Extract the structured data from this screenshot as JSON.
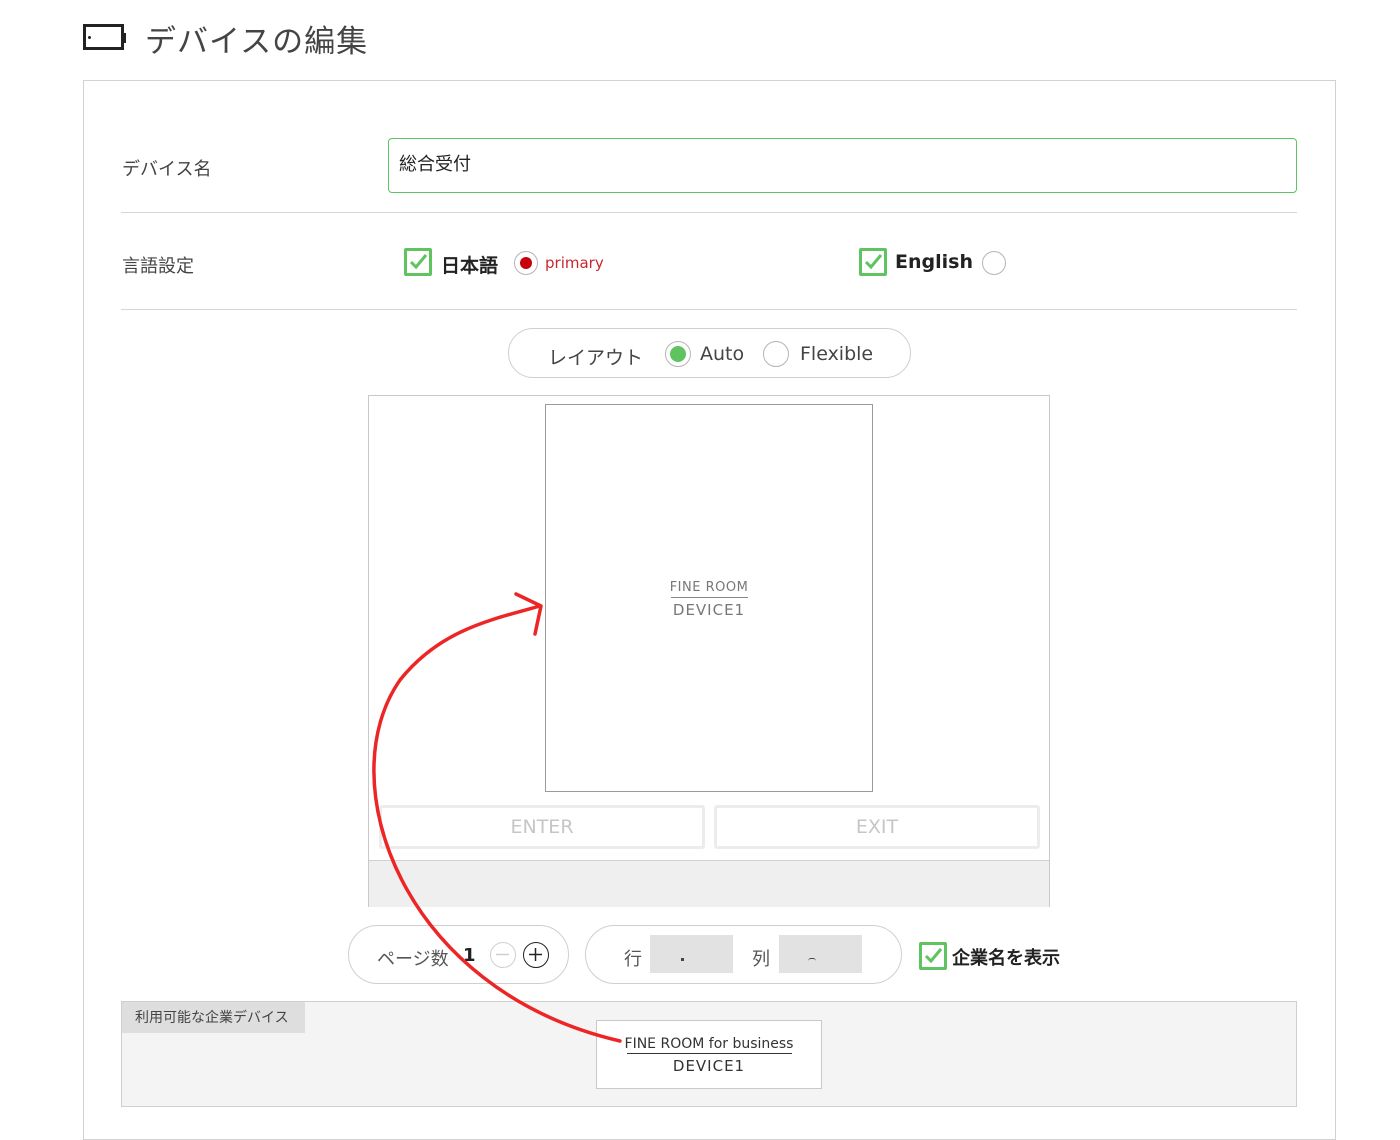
{
  "header": {
    "title": "デバイスの編集",
    "icon": "tablet-icon"
  },
  "form": {
    "device_name_label": "デバイス名",
    "device_name_value": "総合受付",
    "language_label": "言語設定",
    "languages": [
      {
        "label": "日本語",
        "checked": true,
        "primary": true,
        "primary_label": "primary"
      },
      {
        "label": "English",
        "checked": true,
        "primary": false
      }
    ]
  },
  "layout": {
    "label": "レイアウト",
    "options": [
      {
        "label": "Auto",
        "selected": true
      },
      {
        "label": "Flexible",
        "selected": false
      }
    ]
  },
  "preview": {
    "device_top": "FINE ROOM",
    "device_bottom": "DEVICE1",
    "enter_label": "ENTER",
    "exit_label": "EXIT"
  },
  "controls": {
    "page_count_label": "ページ数",
    "page_count_value": "1",
    "row_label": "行",
    "row_value": "",
    "col_label": "列",
    "col_value": "",
    "show_company_label": "企業名を表示",
    "show_company_checked": true
  },
  "available": {
    "tab_label": "利用可能な企業デバイス",
    "card_top": "FINE ROOM for business",
    "card_bottom": "DEVICE1"
  },
  "colors": {
    "accent_green": "#5fc35f",
    "primary_red": "#c8282d",
    "arrow_red": "#ec2626"
  }
}
